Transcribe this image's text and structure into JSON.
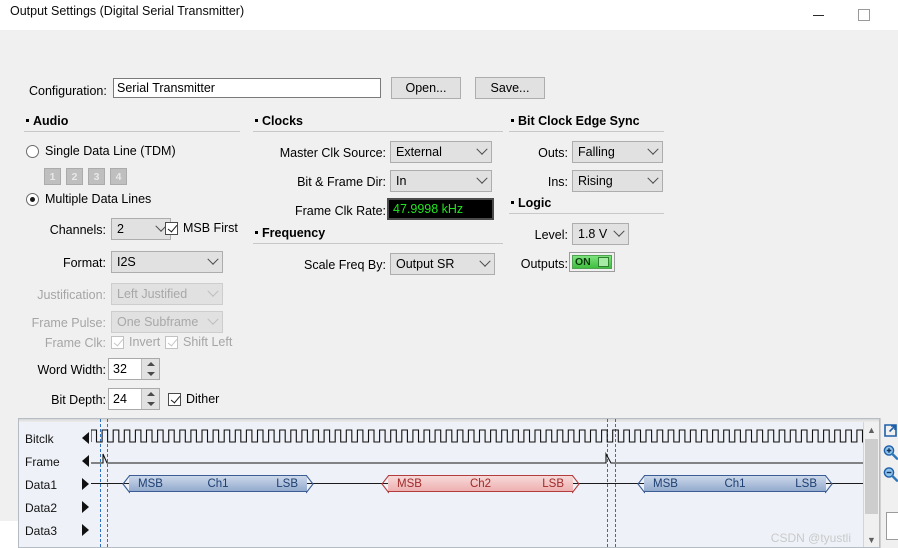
{
  "window": {
    "title": "Output Settings (Digital Serial Transmitter)",
    "minimize_icon": "minimize-icon",
    "maximize_icon": "maximize-icon"
  },
  "config": {
    "label": "Configuration:",
    "value": "Serial Transmitter",
    "placeholder": "",
    "open_label": "Open...",
    "save_label": "Save..."
  },
  "audio": {
    "heading": "Audio",
    "single_data_line": "Single Data Line (TDM)",
    "tdm_buttons": [
      "1",
      "2",
      "3",
      "4"
    ],
    "multiple_data_lines": "Multiple Data Lines",
    "channels_label": "Channels:",
    "channels_value": "2",
    "msb_first_label": "MSB First",
    "format_label": "Format:",
    "format_value": "I2S",
    "justification_label": "Justification:",
    "justification_value": "Left Justified",
    "frame_pulse_label": "Frame Pulse:",
    "frame_pulse_value": "One Subframe",
    "frame_clk_label": "Frame Clk:",
    "invert_label": "Invert",
    "shift_left_label": "Shift Left",
    "word_width_label": "Word Width:",
    "word_width_value": "32",
    "bit_depth_label": "Bit Depth:",
    "bit_depth_value": "24",
    "dither_label": "Dither"
  },
  "clocks": {
    "heading": "Clocks",
    "master_clk_source_label": "Master Clk Source:",
    "master_clk_source_value": "External",
    "bit_frame_dir_label": "Bit & Frame Dir:",
    "bit_frame_dir_value": "In",
    "frame_clk_rate_label": "Frame Clk Rate:",
    "frame_clk_rate_value": "47.9998 kHz",
    "readout_color": "#21e421"
  },
  "frequency": {
    "heading": "Frequency",
    "scale_freq_by_label": "Scale Freq By:",
    "scale_freq_by_value": "Output SR"
  },
  "bit_clock_edge_sync": {
    "heading": "Bit Clock Edge Sync",
    "outs_label": "Outs:",
    "outs_value": "Falling",
    "ins_label": "Ins:",
    "ins_value": "Rising"
  },
  "logic": {
    "heading": "Logic",
    "level_label": "Level:",
    "level_value": "1.8 V",
    "outputs_label": "Outputs:",
    "outputs_state": "ON",
    "on_color": "#3fbe3f"
  },
  "waveform": {
    "rows": [
      {
        "label": "Bitclk",
        "direction": "in"
      },
      {
        "label": "Frame",
        "direction": "in"
      },
      {
        "label": "Data1",
        "direction": "out"
      },
      {
        "label": "Data2",
        "direction": "out"
      },
      {
        "label": "Data3",
        "direction": "out"
      }
    ],
    "buses": [
      {
        "msb": "MSB",
        "name": "Ch1",
        "lsb": "LSB",
        "color": "blue"
      },
      {
        "msb": "MSB",
        "name": "Ch2",
        "lsb": "LSB",
        "color": "red"
      },
      {
        "msb": "MSB",
        "name": "Ch1",
        "lsb": "LSB",
        "color": "blue"
      }
    ],
    "bus_blue_color": "#93aacd",
    "bus_red_color": "#eeb0b0",
    "cursor_color": "#2f6fc0",
    "tools": [
      "expand-icon",
      "zoom-in-icon",
      "zoom-out-icon"
    ],
    "scrollbar_up": "▲",
    "scrollbar_down": "▼"
  },
  "watermark": "CSDN @tyustli"
}
